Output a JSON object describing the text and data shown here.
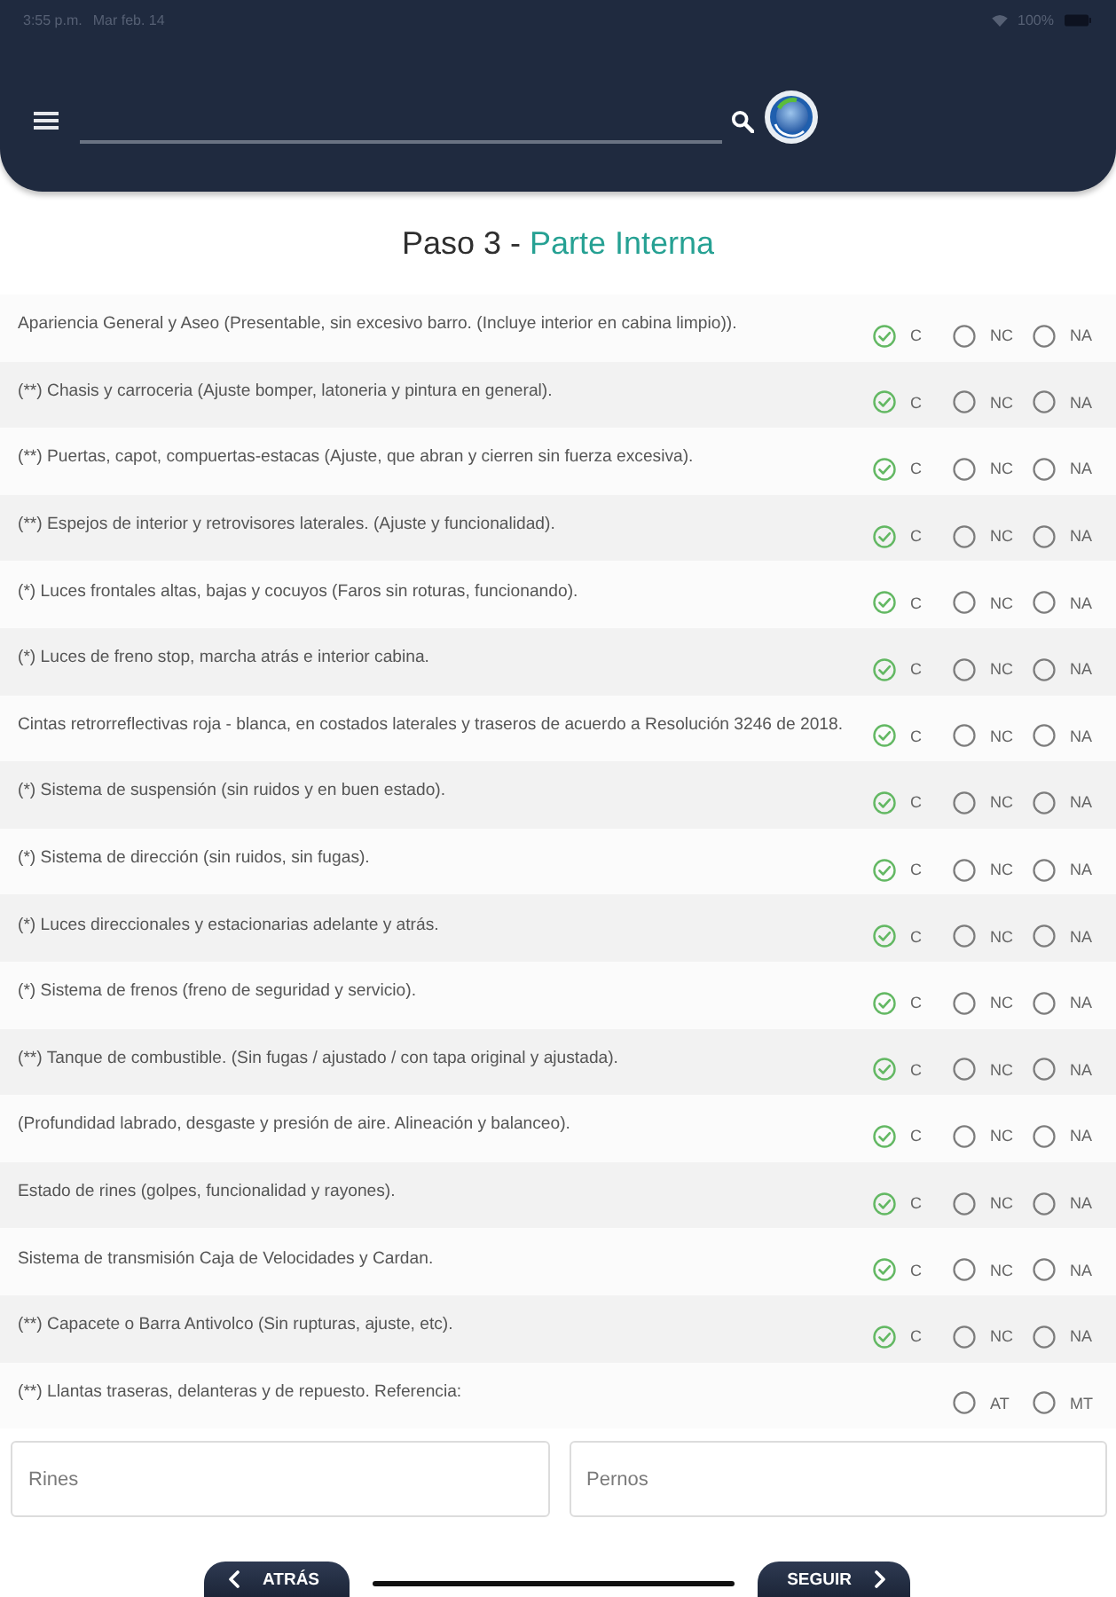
{
  "status_bar": {
    "time": "3:55 p.m.",
    "date": "Mar feb. 14",
    "battery": "100%"
  },
  "title": {
    "step": "Paso 3 -",
    "section": "Parte Interna"
  },
  "items": [
    {
      "text": "Apariencia General y Aseo (Presentable, sin excesivo barro. (Incluye interior en cabina limpio)).",
      "options": [
        {
          "label": "C",
          "selected": true
        },
        {
          "label": "NC",
          "selected": false
        },
        {
          "label": "NA",
          "selected": false
        }
      ]
    },
    {
      "text": "(**) Chasis y carroceria (Ajuste bomper, latoneria y pintura en general).",
      "options": [
        {
          "label": "C",
          "selected": true
        },
        {
          "label": "NC",
          "selected": false
        },
        {
          "label": "NA",
          "selected": false
        }
      ]
    },
    {
      "text": "(**) Puertas, capot, compuertas-estacas (Ajuste, que abran y cierren sin fuerza excesiva).",
      "options": [
        {
          "label": "C",
          "selected": true
        },
        {
          "label": "NC",
          "selected": false
        },
        {
          "label": "NA",
          "selected": false
        }
      ]
    },
    {
      "text": "(**) Espejos de interior y retrovisores laterales. (Ajuste y funcionalidad).",
      "options": [
        {
          "label": "C",
          "selected": true
        },
        {
          "label": "NC",
          "selected": false
        },
        {
          "label": "NA",
          "selected": false
        }
      ]
    },
    {
      "text": "(*) Luces frontales altas, bajas y cocuyos (Faros sin roturas, funcionando).",
      "options": [
        {
          "label": "C",
          "selected": true
        },
        {
          "label": "NC",
          "selected": false
        },
        {
          "label": "NA",
          "selected": false
        }
      ]
    },
    {
      "text": "(*) Luces de freno stop, marcha atrás e interior cabina.",
      "options": [
        {
          "label": "C",
          "selected": true
        },
        {
          "label": "NC",
          "selected": false
        },
        {
          "label": "NA",
          "selected": false
        }
      ]
    },
    {
      "text": "Cintas retrorreflectivas roja - blanca, en costados laterales y traseros de acuerdo a Resolución 3246 de 2018.",
      "options": [
        {
          "label": "C",
          "selected": true
        },
        {
          "label": "NC",
          "selected": false
        },
        {
          "label": "NA",
          "selected": false
        }
      ]
    },
    {
      "text": "(*) Sistema de suspensión (sin ruidos y en buen estado).",
      "options": [
        {
          "label": "C",
          "selected": true
        },
        {
          "label": "NC",
          "selected": false
        },
        {
          "label": "NA",
          "selected": false
        }
      ]
    },
    {
      "text": "(*) Sistema de dirección (sin ruidos, sin fugas).",
      "options": [
        {
          "label": "C",
          "selected": true
        },
        {
          "label": "NC",
          "selected": false
        },
        {
          "label": "NA",
          "selected": false
        }
      ]
    },
    {
      "text": "(*) Luces direccionales y estacionarias adelante y atrás.",
      "options": [
        {
          "label": "C",
          "selected": true
        },
        {
          "label": "NC",
          "selected": false
        },
        {
          "label": "NA",
          "selected": false
        }
      ]
    },
    {
      "text": "(*) Sistema de frenos (freno de seguridad y servicio).",
      "options": [
        {
          "label": "C",
          "selected": true
        },
        {
          "label": "NC",
          "selected": false
        },
        {
          "label": "NA",
          "selected": false
        }
      ]
    },
    {
      "text": "(**) Tanque de combustible. (Sin fugas / ajustado / con tapa original y ajustada).",
      "options": [
        {
          "label": "C",
          "selected": true
        },
        {
          "label": "NC",
          "selected": false
        },
        {
          "label": "NA",
          "selected": false
        }
      ]
    },
    {
      "text": "(Profundidad labrado, desgaste y presión de aire. Alineación y balanceo).",
      "options": [
        {
          "label": "C",
          "selected": true
        },
        {
          "label": "NC",
          "selected": false
        },
        {
          "label": "NA",
          "selected": false
        }
      ]
    },
    {
      "text": "Estado de rines (golpes, funcionalidad y rayones).",
      "options": [
        {
          "label": "C",
          "selected": true
        },
        {
          "label": "NC",
          "selected": false
        },
        {
          "label": "NA",
          "selected": false
        }
      ]
    },
    {
      "text": "Sistema de transmisión Caja de Velocidades y Cardan.",
      "options": [
        {
          "label": "C",
          "selected": true
        },
        {
          "label": "NC",
          "selected": false
        },
        {
          "label": "NA",
          "selected": false
        }
      ]
    },
    {
      "text": "(**) Capacete o Barra Antivolco (Sin rupturas, ajuste, etc).",
      "options": [
        {
          "label": "C",
          "selected": true
        },
        {
          "label": "NC",
          "selected": false
        },
        {
          "label": "NA",
          "selected": false
        }
      ]
    },
    {
      "text": "(**) Llantas traseras, delanteras y de repuesto. Referencia:",
      "options": [
        {
          "label": "AT",
          "selected": false
        },
        {
          "label": "MT",
          "selected": false
        }
      ]
    }
  ],
  "fields": [
    {
      "placeholder": "Rines"
    },
    {
      "placeholder": "Pernos"
    }
  ],
  "buttons": [
    {
      "label": "ATRÁS",
      "kind": "back"
    },
    {
      "label": "SEGUIR",
      "kind": "next"
    }
  ]
}
